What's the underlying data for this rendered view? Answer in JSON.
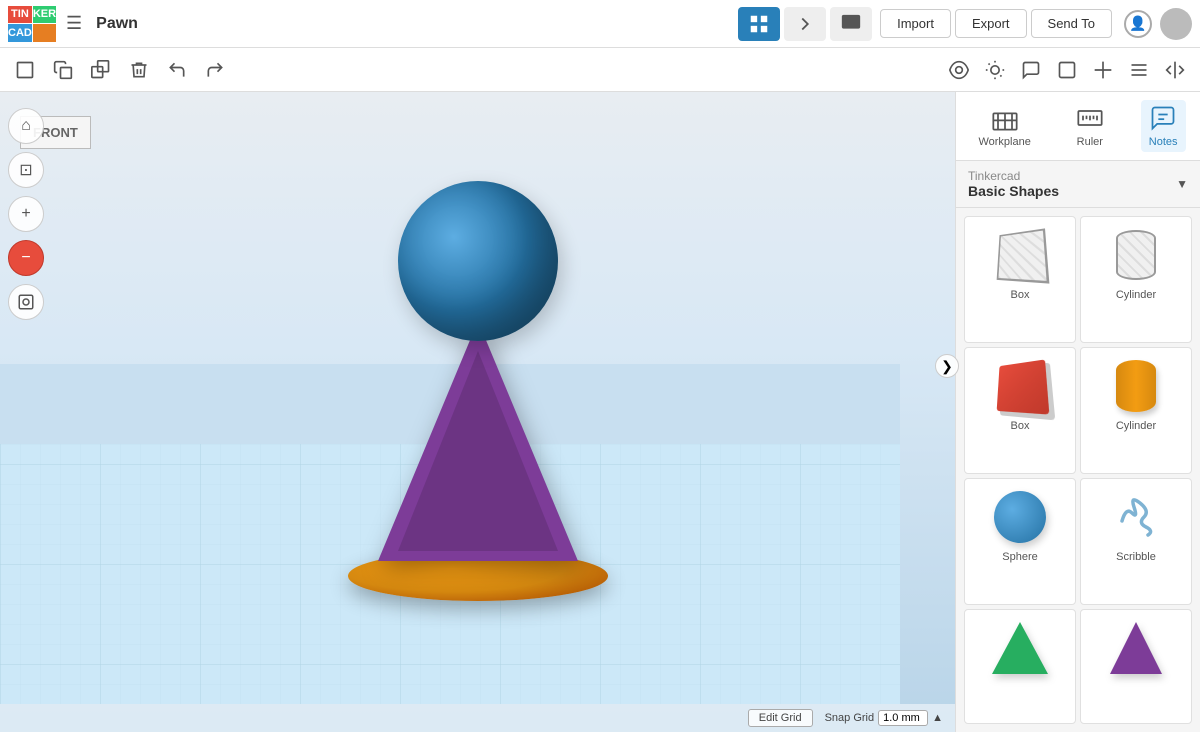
{
  "app": {
    "logo": {
      "letters": [
        "TIN",
        "KER",
        "CAD",
        ""
      ]
    },
    "project_name": "Pawn",
    "menu_icon": "☰"
  },
  "topbar": {
    "tabs": [
      {
        "id": "grid",
        "label": "Grid view",
        "icon": "grid",
        "active": true
      },
      {
        "id": "code",
        "label": "Code editor",
        "icon": "code",
        "active": false
      },
      {
        "id": "simulate",
        "label": "Simulate",
        "icon": "simulate",
        "active": false
      }
    ],
    "actions": [
      {
        "id": "import",
        "label": "Import"
      },
      {
        "id": "export",
        "label": "Export"
      },
      {
        "id": "send-to",
        "label": "Send To"
      }
    ]
  },
  "toolbar2": {
    "buttons": [
      {
        "id": "new",
        "icon": "□",
        "label": "New"
      },
      {
        "id": "copy-to",
        "icon": "⧉",
        "label": "Copy to"
      },
      {
        "id": "duplicate",
        "icon": "⊞",
        "label": "Duplicate"
      },
      {
        "id": "delete",
        "icon": "🗑",
        "label": "Delete"
      },
      {
        "id": "undo",
        "icon": "↩",
        "label": "Undo"
      },
      {
        "id": "redo",
        "icon": "↪",
        "label": "Redo"
      }
    ],
    "right_buttons": [
      {
        "id": "camera",
        "icon": "📷",
        "label": "Camera"
      },
      {
        "id": "light",
        "icon": "💡",
        "label": "Light"
      },
      {
        "id": "notes-view",
        "icon": "💬",
        "label": "Notes"
      },
      {
        "id": "shape1",
        "icon": "◻",
        "label": ""
      },
      {
        "id": "shape2",
        "icon": "◁",
        "label": ""
      },
      {
        "id": "align",
        "icon": "⊟",
        "label": "Align"
      },
      {
        "id": "mirror",
        "icon": "⇔",
        "label": "Mirror"
      }
    ]
  },
  "viewport": {
    "front_label": "FRONT",
    "bottom_bar": {
      "edit_grid_label": "Edit Grid",
      "snap_grid_label": "Snap Grid",
      "snap_grid_value": "1.0 mm"
    }
  },
  "left_controls": [
    {
      "id": "home",
      "icon": "⌂",
      "label": "Home"
    },
    {
      "id": "fit",
      "icon": "⊞",
      "label": "Fit"
    },
    {
      "id": "zoom-in",
      "icon": "+",
      "label": "Zoom in"
    },
    {
      "id": "zoom-out",
      "icon": "−",
      "label": "Zoom out"
    },
    {
      "id": "orientation",
      "icon": "⊛",
      "label": "Orientation"
    }
  ],
  "right_panel": {
    "icons": [
      {
        "id": "workplane",
        "label": "Workplane",
        "active": false
      },
      {
        "id": "ruler",
        "label": "Ruler",
        "active": false
      },
      {
        "id": "notes",
        "label": "Notes",
        "active": true
      }
    ],
    "library": {
      "category": "Tinkercad",
      "title": "Basic Shapes",
      "dropdown_icon": "▼"
    },
    "shapes": [
      {
        "id": "box-hatch",
        "label": "Box",
        "type": "box-hatch"
      },
      {
        "id": "cylinder-hatch",
        "label": "Cylinder",
        "type": "cylinder-hatch"
      },
      {
        "id": "box-red",
        "label": "Box",
        "type": "box-red"
      },
      {
        "id": "cylinder-orange",
        "label": "Cylinder",
        "type": "cylinder-orange"
      },
      {
        "id": "sphere-blue",
        "label": "Sphere",
        "type": "sphere-blue"
      },
      {
        "id": "scribble",
        "label": "Scribble",
        "type": "scribble"
      },
      {
        "id": "pyramid-green",
        "label": "",
        "type": "pyramid-green"
      },
      {
        "id": "cone-purple",
        "label": "",
        "type": "cone-purple"
      }
    ]
  },
  "panel_toggle": "❯"
}
